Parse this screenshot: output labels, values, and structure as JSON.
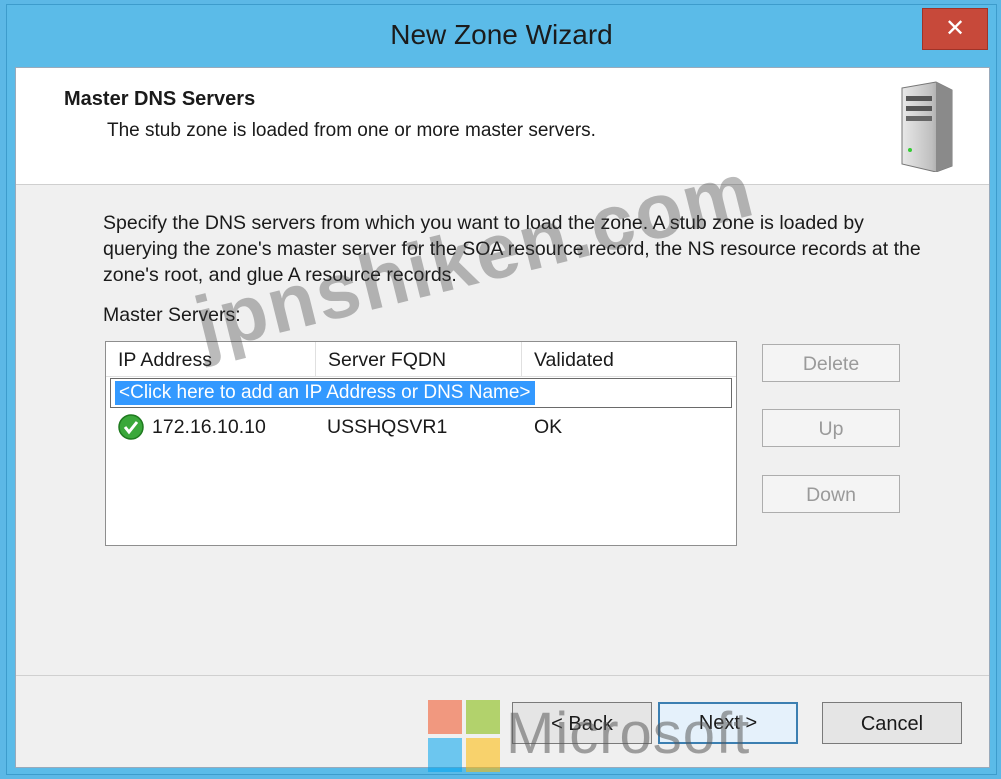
{
  "window": {
    "title": "New Zone Wizard",
    "close_glyph": "✕"
  },
  "header": {
    "title": "Master DNS Servers",
    "subtitle": "The stub zone is loaded from one or more master servers.",
    "icon": "server-icon"
  },
  "body": {
    "description": "Specify the DNS servers from which you want to load the zone. A stub zone is loaded by querying the zone's master server for the SOA resource record, the NS resource records at the zone's root, and glue A resource records.",
    "master_label": "Master Servers:"
  },
  "list": {
    "columns": [
      "IP Address",
      "Server FQDN",
      "Validated"
    ],
    "add_placeholder": "<Click here to add an IP Address or DNS Name>",
    "rows": [
      {
        "status_icon": "check-icon",
        "ip": "172.16.10.10",
        "fqdn": "USSHQSVR1",
        "validated": "OK"
      }
    ]
  },
  "side_buttons": {
    "delete": "Delete",
    "up": "Up",
    "down": "Down"
  },
  "footer": {
    "back": "< Back",
    "next": "Next >",
    "cancel": "Cancel"
  },
  "watermarks": {
    "site": "jpnshiken.com",
    "brand": "Microsoft"
  },
  "colors": {
    "titlebar": "#5bbbe8",
    "close": "#c7493a",
    "selection": "#3399ff",
    "check": "#3aa83a"
  }
}
